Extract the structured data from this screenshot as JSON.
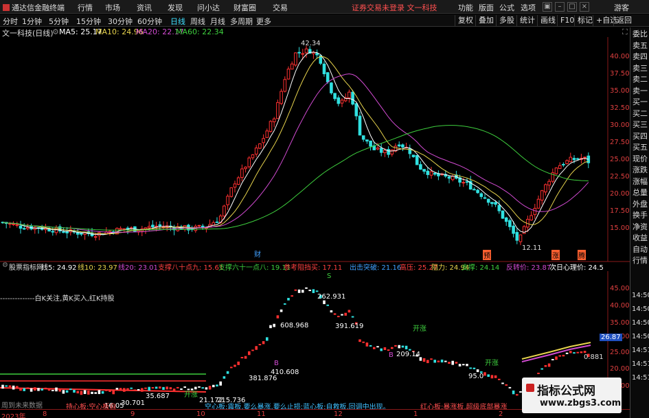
{
  "menubar": {
    "app_title": "通达信金融终端",
    "menus": [
      "行情",
      "市场",
      "资讯",
      "发现",
      "问小达",
      "财富圈",
      "交易"
    ],
    "login_text": "证券交易未登录  文一科技",
    "right_menus": [
      "功能",
      "版面",
      "公式",
      "选项"
    ],
    "guest": "游客"
  },
  "toolbar": {
    "periods": [
      "分时",
      "1分钟",
      "5分钟",
      "15分钟",
      "30分钟",
      "60分钟",
      "日线",
      "周线",
      "月线",
      "多周期",
      "更多"
    ],
    "active_period": "日线",
    "right_tools": [
      "复权",
      "叠加",
      "多股",
      "统计",
      "画线",
      "F10",
      "标记",
      "+自选",
      "返回"
    ]
  },
  "main_info": {
    "stock_title": "文一科技(日线)",
    "ma5": "MA5: 25.17",
    "ma10": "MA10: 24.96",
    "ma20": "MA20: 22.17",
    "ma60": "MA60: 22.34",
    "colors": {
      "ma5": "#ffffff",
      "ma10": "#e8d44d",
      "ma20": "#d24bd2",
      "ma60": "#3ecf3e"
    }
  },
  "price_axis": [
    "40.00",
    "37.50",
    "35.00",
    "32.50",
    "30.00",
    "27.50",
    "25.00",
    "22.50",
    "20.00",
    "17.50",
    "15.00"
  ],
  "main_annotations": {
    "high": "42.34",
    "low": "12.11",
    "marks": [
      "财",
      "预",
      "涨",
      "腾"
    ]
  },
  "sub_info": {
    "title": "股票指标网",
    "items": [
      {
        "text": "线5: 24.92",
        "color": "#ffffff"
      },
      {
        "text": "线10: 23.97",
        "color": "#e8d44d"
      },
      {
        "text": "线20: 23.01",
        "color": "#d24bd2"
      },
      {
        "text": "支撑八十点九: 15.61",
        "color": "#ff4040"
      },
      {
        "text": "支撑六十一点八: 19.11",
        "color": "#3ecf3e"
      },
      {
        "text": "参考阻挡买: 17.11",
        "color": "#ff4040"
      },
      {
        "text": "出击突破: 21.16",
        "color": "#40a0ff"
      },
      {
        "text": "高压: 25.27",
        "color": "#ff4040"
      },
      {
        "text": "阻力: 24.94",
        "color": "#e8d44d"
      },
      {
        "text": "支撑: 24.14",
        "color": "#3ecf3e"
      },
      {
        "text": "反转价: 23.87",
        "color": "#d24bd2"
      },
      {
        "text": "次日心理价: 24.5",
        "color": "#ffffff"
      }
    ],
    "legend_line": "--------------白K关注,黄K买入,红K持股"
  },
  "sub_axis": [
    "45.00",
    "40.00",
    "35.00",
    "30.00",
    "25.00",
    "20.00",
    "15.00"
  ],
  "sub_price_tag": "26.87",
  "sub_annotations": {
    "values": [
      "262.931",
      "608.968",
      "391.619",
      "209.14",
      "410.608",
      "381.876",
      "95.0",
      "21.172",
      "215.736",
      "35.687",
      "30.701",
      "16.05",
      "0.881"
    ],
    "bottom_text": "空心板:震板,要么暴涨,要么止损;蓝心板:自救板,回调中出现。",
    "bottom_text2": "红心板:暴涨板,超级底部暴涨",
    "s_mark": "S",
    "b_mark": "B",
    "kaizhang": "开涨",
    "left_notice": "周到未来数据",
    "left_notice2": "持心板:空心板自"
  },
  "date_axis": [
    "2023年",
    "8",
    "9",
    "10",
    "11",
    "12",
    "1",
    "2"
  ],
  "right_tabs": [
    "委比",
    "卖五",
    "卖四",
    "卖三",
    "卖二",
    "卖一",
    "买一",
    "买二",
    "买三",
    "买四",
    "买五",
    "现价",
    "涨跌",
    "涨幅",
    "总量",
    "外盘",
    "换手",
    "净资",
    "收益",
    "自动",
    "行情"
  ],
  "right_times": [
    "14:50",
    "14:50",
    "14:50",
    "14:50",
    "14:51",
    "14:51",
    "14:51"
  ],
  "watermark": {
    "title": "指标公式网",
    "url": "www.zbgs3.com"
  }
}
